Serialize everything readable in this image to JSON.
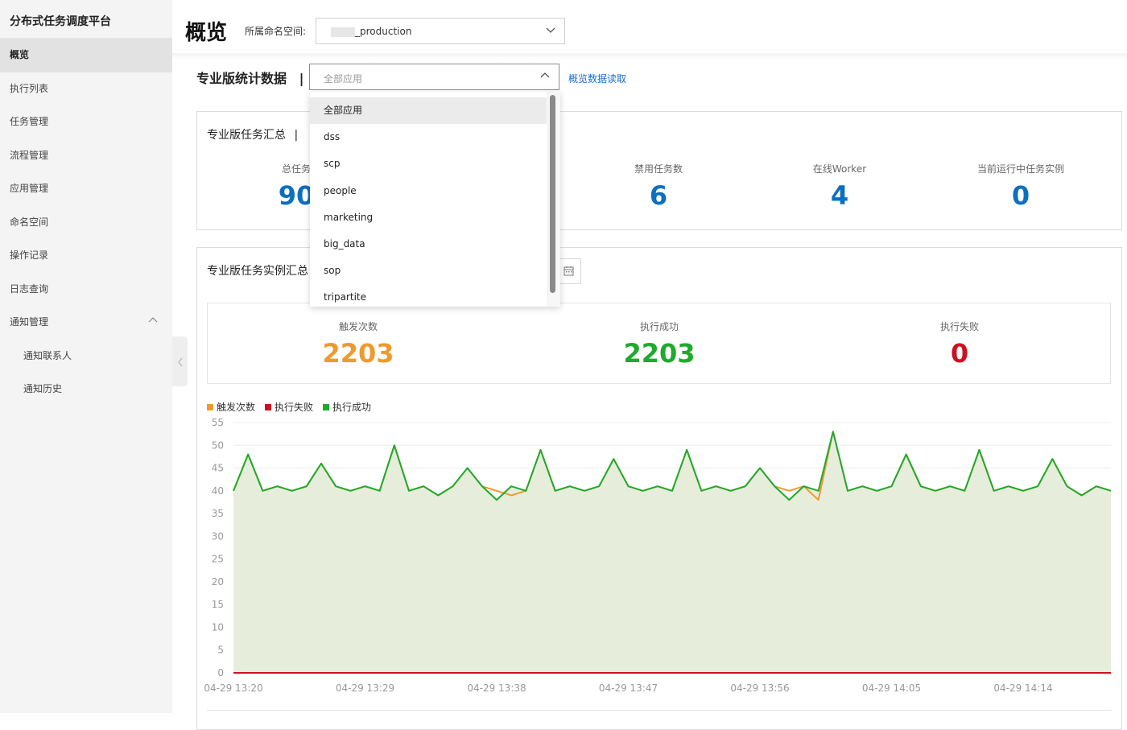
{
  "app": {
    "brand": "分布式任务调度平台"
  },
  "sidebar": {
    "items": [
      {
        "label": "概览"
      },
      {
        "label": "执行列表"
      },
      {
        "label": "任务管理"
      },
      {
        "label": "流程管理"
      },
      {
        "label": "应用管理"
      },
      {
        "label": "命名空间"
      },
      {
        "label": "操作记录"
      },
      {
        "label": "日志查询"
      },
      {
        "label": "通知管理"
      },
      {
        "label": "通知联系人"
      },
      {
        "label": "通知历史"
      }
    ]
  },
  "header": {
    "title": "概览",
    "namespace_label": "所属命名空间:",
    "namespace_value": "_production"
  },
  "stats_section": {
    "title": "专业版统计数据",
    "divider": "|",
    "app_select_value": "全部应用",
    "read_link": "概览数据读取"
  },
  "dropdown": {
    "options": [
      "全部应用",
      "dss",
      "scp",
      "people",
      "marketing",
      "big_data",
      "sop",
      "tripartite"
    ]
  },
  "task_summary": {
    "title": "专业版任务汇总",
    "divider": "|",
    "stats": [
      {
        "label": "总任务数",
        "label_visible": "总任务",
        "value": "90",
        "color": "#0d6fbf"
      },
      {
        "label": "禁用任务数",
        "value": "6",
        "color": "#0d6fbf"
      },
      {
        "label": "在线Worker",
        "value": "4",
        "color": "#0d6fbf"
      },
      {
        "label": "当前运行中任务实例",
        "value": "0",
        "color": "#0d6fbf"
      }
    ]
  },
  "instance_summary": {
    "title": "专业版任务实例汇总",
    "title_visible": "专业版任务实例汇总",
    "stats": [
      {
        "label": "触发次数",
        "value": "2203",
        "color": "#ef9a30"
      },
      {
        "label": "执行成功",
        "value": "2203",
        "color": "#1faa2d"
      },
      {
        "label": "执行失败",
        "value": "0",
        "color": "#cc1122"
      }
    ]
  },
  "chart_data": {
    "type": "line",
    "legend": [
      {
        "name": "触发次数",
        "color": "#ef9a30"
      },
      {
        "name": "执行失败",
        "color": "#cc1122"
      },
      {
        "name": "执行成功",
        "color": "#1faa2d"
      }
    ],
    "legend_position": "top-left",
    "x_tick_labels": [
      "04-29 13:20",
      "04-29 13:29",
      "04-29 13:38",
      "04-29 13:47",
      "04-29 13:56",
      "04-29 14:05",
      "04-29 14:14"
    ],
    "ylim": [
      0,
      55
    ],
    "y_ticks": [
      0,
      5,
      10,
      15,
      20,
      25,
      30,
      35,
      40,
      45,
      50,
      55
    ],
    "grid": true,
    "area_fill": "#e6eedb",
    "series": [
      {
        "name": "执行成功",
        "color": "#1faa2d",
        "values": [
          40,
          48,
          40,
          41,
          40,
          41,
          46,
          41,
          40,
          41,
          40,
          50,
          40,
          41,
          39,
          41,
          45,
          41,
          38,
          41,
          40,
          49,
          40,
          41,
          40,
          41,
          47,
          41,
          40,
          41,
          40,
          49,
          40,
          41,
          40,
          41,
          45,
          41,
          38,
          41,
          40,
          53,
          40,
          41,
          40,
          41,
          48,
          41,
          40,
          41,
          40,
          49,
          40,
          41,
          40,
          41,
          47,
          41,
          39,
          41,
          40
        ]
      },
      {
        "name": "触发次数",
        "color": "#ef9a30",
        "values": [
          40,
          48,
          40,
          41,
          40,
          41,
          46,
          41,
          40,
          41,
          40,
          50,
          40,
          41,
          39,
          41,
          45,
          41,
          40,
          39,
          40,
          49,
          40,
          41,
          40,
          41,
          47,
          41,
          40,
          41,
          40,
          49,
          40,
          41,
          40,
          41,
          45,
          41,
          40,
          41,
          38,
          53,
          40,
          41,
          40,
          41,
          48,
          41,
          40,
          41,
          40,
          49,
          40,
          41,
          40,
          41,
          47,
          41,
          39,
          41,
          40
        ]
      },
      {
        "name": "执行失败",
        "color": "#cc1122",
        "values": [
          0,
          0,
          0,
          0,
          0,
          0,
          0,
          0,
          0,
          0,
          0,
          0,
          0,
          0,
          0,
          0,
          0,
          0,
          0,
          0,
          0,
          0,
          0,
          0,
          0,
          0,
          0,
          0,
          0,
          0,
          0,
          0,
          0,
          0,
          0,
          0,
          0,
          0,
          0,
          0,
          0,
          0,
          0,
          0,
          0,
          0,
          0,
          0,
          0,
          0,
          0,
          0,
          0,
          0,
          0,
          0,
          0,
          0,
          0,
          0,
          0
        ]
      }
    ]
  }
}
